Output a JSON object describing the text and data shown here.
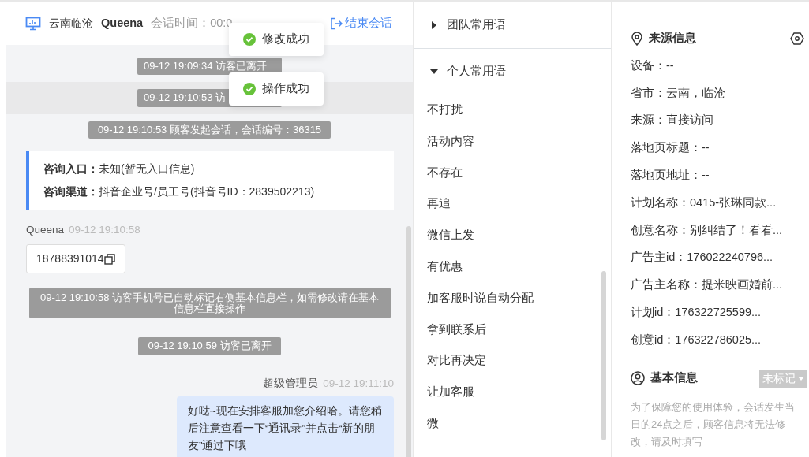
{
  "header": {
    "location": "云南临沧",
    "visitor": "Queena",
    "session_time": "会话时间：00:0",
    "end_button": "结束会话"
  },
  "toasts": [
    {
      "text": "修改成功"
    },
    {
      "text": "操作成功"
    }
  ],
  "messages": [
    {
      "kind": "notice",
      "text": "09-12 19:09:34 访客已离开",
      "highlighted": false
    },
    {
      "kind": "notice",
      "text": "09-12 19:10:53 访",
      "highlighted": true
    },
    {
      "kind": "notice",
      "text": "09-12 19:10:53 顾客发起会话，会话编号：36315",
      "highlighted": false
    },
    {
      "kind": "info",
      "entries": [
        {
          "label": "咨询入口：",
          "value": "未知(暂无入口信息)"
        },
        {
          "label": "咨询渠道：",
          "value": "抖音企业号/员工号(抖音号ID：2839502213)"
        }
      ]
    },
    {
      "kind": "visitor",
      "sender": "Queena",
      "time": "09-12 19:10:58",
      "text": "18788391014"
    },
    {
      "kind": "notice",
      "text": "09-12 19:10:58 访客手机号已自动标记右侧基本信息栏，如需修改请在基本信息栏直接操作",
      "highlighted": false
    },
    {
      "kind": "notice",
      "text": "09-12 19:10:59 访客已离开",
      "highlighted": false
    },
    {
      "kind": "agent",
      "sender": "超级管理员",
      "time": "09-12 19:11:10",
      "text": "好哒~现在安排客服加您介绍哈。请您稍后注意查看一下“通讯录”并点击“新的朋友”通过下哦"
    }
  ],
  "phrase_groups": [
    {
      "title": "团队常用语",
      "expanded": false
    },
    {
      "title": "个人常用语",
      "expanded": true,
      "items": [
        "不打扰",
        "活动内容",
        "不存在",
        "再追",
        "微信上发",
        "有优惠",
        "加客服时说自动分配",
        "拿到联系后",
        "对比再决定",
        "让加客服",
        "微"
      ]
    }
  ],
  "source_info": {
    "title": "来源信息",
    "rows": [
      "设备：--",
      "省市：云南，临沧",
      "来源：直接访问",
      "落地页标题：--",
      "落地页地址：--",
      "计划名称：0415-张琳同款...",
      "创意名称：别纠结了！看看...",
      "广告主id：176022240796...",
      "广告主名称：提米映画婚前...",
      "计划id：176322725599...",
      "创意id：176322786025..."
    ]
  },
  "basic_info": {
    "title": "基本信息",
    "tag": "未标记",
    "notice": "为了保障您的使用体验，会话发生当日的24点之后，顾客信息将无法修改，请及时填写"
  }
}
